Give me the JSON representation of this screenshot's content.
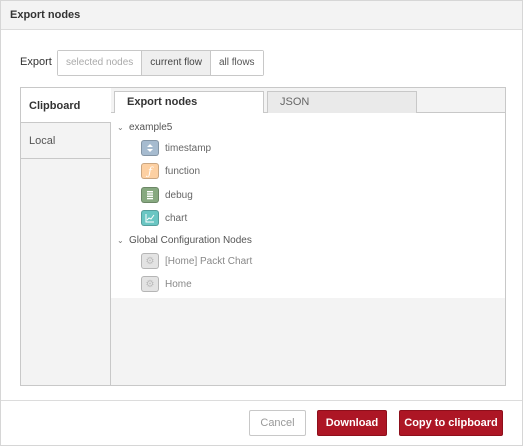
{
  "dialog": {
    "title": "Export nodes"
  },
  "export": {
    "label": "Export",
    "options": [
      "selected nodes",
      "current flow",
      "all flows"
    ],
    "active": "current flow"
  },
  "sidetabs": [
    "Clipboard",
    "Local"
  ],
  "tabs": [
    "Export nodes",
    "JSON"
  ],
  "tree": {
    "flow_label": "example5",
    "flow_nodes": [
      {
        "label": "timestamp",
        "icon": "arrows-icon",
        "color": "#a6bbcf"
      },
      {
        "label": "function",
        "icon": "function-icon",
        "color": "#fdd0a2"
      },
      {
        "label": "debug",
        "icon": "list-icon",
        "color": "#87a980"
      },
      {
        "label": "chart",
        "icon": "chart-icon",
        "color": "#6ac6c3"
      }
    ],
    "config_label": "Global Configuration Nodes",
    "config_nodes": [
      {
        "label": "[Home] Packt Chart",
        "icon": "gear-icon"
      },
      {
        "label": "Home",
        "icon": "gear-icon"
      }
    ]
  },
  "footer": {
    "cancel": "Cancel",
    "download": "Download",
    "copy": "Copy to clipboard"
  },
  "colors": {
    "primary": "#ad1625"
  }
}
